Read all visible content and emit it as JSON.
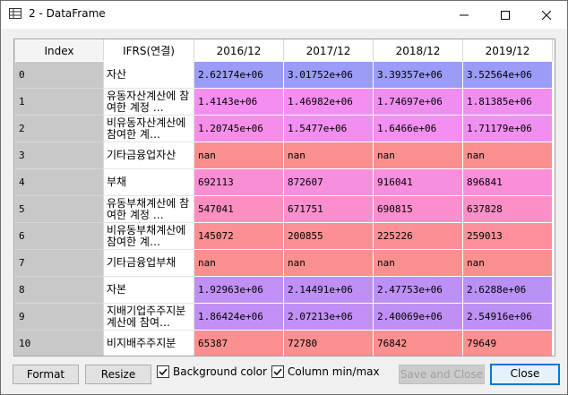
{
  "window": {
    "title": "2 - DataFrame"
  },
  "table": {
    "index_header": "Index",
    "columns": [
      "IFRS(연결)",
      "2016/12",
      "2017/12",
      "2018/12",
      "2019/12"
    ],
    "rows": [
      {
        "index": "0",
        "label": "자산",
        "values": [
          "2.62174e+06",
          "3.01752e+06",
          "3.39357e+06",
          "3.52564e+06"
        ],
        "colors": [
          "#9b9bf8",
          "#9b9bf8",
          "#9b9bf8",
          "#9b9bf8"
        ]
      },
      {
        "index": "1",
        "label": "유동자산계산에 참여한 계정 …",
        "values": [
          "1.4143e+06",
          "1.46982e+06",
          "1.74697e+06",
          "1.81385e+06"
        ],
        "colors": [
          "#f48ef0",
          "#f48ef0",
          "#f08ef0",
          "#ef8ff0"
        ]
      },
      {
        "index": "2",
        "label": "비유동자산계산에 참여한 계…",
        "values": [
          "1.20745e+06",
          "1.5477e+06",
          "1.6466e+06",
          "1.71179e+06"
        ],
        "colors": [
          "#f68ee8",
          "#f28eef",
          "#f28ff0",
          "#f18ff0"
        ]
      },
      {
        "index": "3",
        "label": "기타금융업자산",
        "values": [
          "nan",
          "nan",
          "nan",
          "nan"
        ],
        "colors": [
          "#fa8f8f",
          "#fa8f8f",
          "#fa8f8f",
          "#fa8f8f"
        ]
      },
      {
        "index": "4",
        "label": "부채",
        "values": [
          "692113",
          "872607",
          "916041",
          "896841"
        ],
        "colors": [
          "#fa8ed4",
          "#f88ede",
          "#f88ede",
          "#fa8ed8"
        ]
      },
      {
        "index": "5",
        "label": "유동부채계산에 참여한 계정 …",
        "values": [
          "547041",
          "671751",
          "690815",
          "637828"
        ],
        "colors": [
          "#fb8fbf",
          "#fa8ecf",
          "#fa8ecf",
          "#fb8fc7"
        ]
      },
      {
        "index": "6",
        "label": "비유동부채계산에 참여한 계…",
        "values": [
          "145072",
          "200855",
          "225226",
          "259013"
        ],
        "colors": [
          "#fc8f93",
          "#fc8f96",
          "#fc8f96",
          "#fc8f9a"
        ]
      },
      {
        "index": "7",
        "label": "기타금융업부채",
        "values": [
          "nan",
          "nan",
          "nan",
          "nan"
        ],
        "colors": [
          "#fa8f8f",
          "#fa8f8f",
          "#fa8f8f",
          "#fa8f8f"
        ]
      },
      {
        "index": "8",
        "label": "자본",
        "values": [
          "1.92963e+06",
          "2.14491e+06",
          "2.47753e+06",
          "2.6288e+06"
        ],
        "colors": [
          "#c090f4",
          "#bf90f4",
          "#bc90f4",
          "#b991f4"
        ]
      },
      {
        "index": "9",
        "label": "지배기업주주지분계산에 참여…",
        "values": [
          "1.86424e+06",
          "2.07213e+06",
          "2.40069e+06",
          "2.54916e+06"
        ],
        "colors": [
          "#c290f4",
          "#c190f4",
          "#bf90f4",
          "#bc90f4"
        ]
      },
      {
        "index": "10",
        "label": "비지배주주지분",
        "values": [
          "65387",
          "72780",
          "76842",
          "79649"
        ],
        "colors": [
          "#fc8f8f",
          "#fc8f8f",
          "#fc8f8f",
          "#fc8f8f"
        ]
      }
    ]
  },
  "buttons": {
    "format": "Format",
    "resize": "Resize",
    "save_close": "Save and Close",
    "close": "Close"
  },
  "checkboxes": {
    "background_color": {
      "label": "Background color",
      "checked": true
    },
    "column_min_max": {
      "label": "Column min/max",
      "checked": true
    }
  }
}
